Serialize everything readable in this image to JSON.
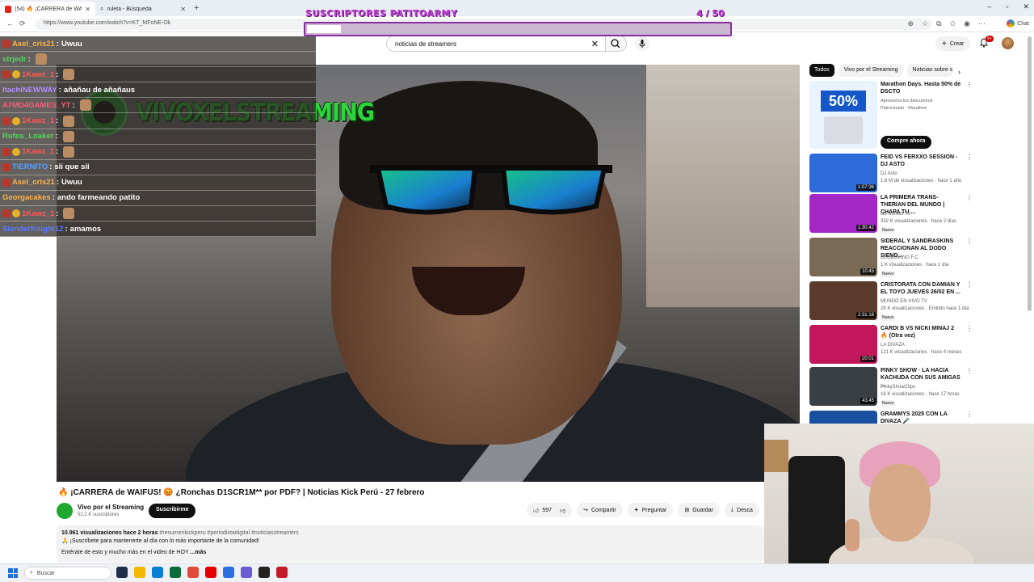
{
  "browser": {
    "tabs": [
      {
        "label": "(54) 🔥 ¡CARRERA de WAIFUS! 😡",
        "active": true
      },
      {
        "label": "ruleta - Búsqueda",
        "active": false
      }
    ],
    "new_tab": "+",
    "url": "https://www.youtube.com/watch?v=KT_MFoNE-Ok",
    "chat_button": "Chat"
  },
  "overlay": {
    "title": "SUSCRIPTORES PATITOARMY",
    "count": "4 / 50",
    "progress": 0.08
  },
  "youtube": {
    "search_value": "noticias de streamers",
    "create_label": "Crear",
    "notifications_badge": "9+"
  },
  "video": {
    "logo_text": "VIVOXELSTREAMING",
    "title": "🔥 ¡CARRERA de WAIFUS! 😡 ¿Ronchas D1SCR1M** por PDF? | Noticias Kick Perú - 27 febrero",
    "channel": "Vivo por el Streaming",
    "subscribers": "52,2 K suscriptores",
    "subscribe_label": "Suscribirme",
    "likes": "597",
    "share_label": "Compartir",
    "ask_label": "Preguntar",
    "save_label": "Guardar",
    "download_label": "Desca",
    "desc_stats": "10.961 visualizaciones  hace 2 horas",
    "desc_tags": "#resumenkickperu #periodistadigital #noticiasstreamers",
    "desc_line2": "🙏 ¡Suscríbete para mantenerte al día con lo más importante de la comunidad!",
    "desc_line3": "Entérate de esto y mucho más en el video de HOY",
    "desc_more": "...más"
  },
  "chat": [
    {
      "user": "Axel_cris21",
      "color": "#ffb347",
      "badges": [
        "badge1"
      ],
      "msg": "Uwuu",
      "emote": false
    },
    {
      "user": "strjedr",
      "color": "#4ddc5b",
      "badges": [],
      "msg": "",
      "emote": true
    },
    {
      "user": "1Kawz_1",
      "color": "#ff5a5a",
      "badges": [
        "badge1",
        "badge2"
      ],
      "msg": "",
      "emote": true
    },
    {
      "user": "ItachiNEWWAY",
      "color": "#b28cff",
      "badges": [],
      "msg": "añañau de añañaus",
      "emote": false
    },
    {
      "user": "A7MD4GAMES_YT",
      "color": "#ff5a7a",
      "badges": [],
      "msg": "",
      "emote": true
    },
    {
      "user": "1Kawz_1",
      "color": "#ff5a5a",
      "badges": [
        "badge1",
        "badge2"
      ],
      "msg": "",
      "emote": true
    },
    {
      "user": "Rufos_Loaker",
      "color": "#4ddc5b",
      "badges": [],
      "msg": "",
      "emote": true
    },
    {
      "user": "1Kawz_1",
      "color": "#ff5a5a",
      "badges": [
        "badge1",
        "badge2"
      ],
      "msg": "",
      "emote": true
    },
    {
      "user": "TIERNITO",
      "color": "#5aa0ff",
      "badges": [
        "badge1"
      ],
      "msg": "sii que sii",
      "emote": false
    },
    {
      "user": "Axel_cris21",
      "color": "#ffb347",
      "badges": [
        "badge1"
      ],
      "msg": "Uwuu",
      "emote": false
    },
    {
      "user": "Georgacakes",
      "color": "#ffb347",
      "badges": [],
      "msg": "ando farmeando patito",
      "emote": false
    },
    {
      "user": "1Kawz_1",
      "color": "#ff5a5a",
      "badges": [
        "badge1",
        "badge2"
      ],
      "msg": "",
      "emote": true
    },
    {
      "user": "SlenderKnight12",
      "color": "#5a7aff",
      "badges": [],
      "msg": "amamos",
      "emote": false
    }
  ],
  "sidebar": {
    "chips": [
      "Todos",
      "Vivo por el Streaming",
      "Noticias sobre s"
    ],
    "ad": {
      "thumb_text": "50%",
      "title": "Marathon Days. Hasta 50% de DSCTO",
      "subtitle": "Aprovecha los descuentos",
      "sponsor": "Patrocinado · Marathon",
      "cta": "Compre ahora"
    },
    "items": [
      {
        "title": "FEID VS FERXXO SESSION - DJ ASTO",
        "channel": "DJ Asto",
        "views": "1,6 M de visualizaciones · hace 1 año",
        "duration": "1:07:36",
        "new": "",
        "thumb": "#2d6bd8"
      },
      {
        "title": "LA PRIMERA TRANS-THERIAN DEL MUNDO | CHAPA TU ...",
        "channel": "No Somos TV",
        "views": "332 K visualizaciones · hace 2 días",
        "duration": "1:30:42",
        "new": "Nuevo",
        "thumb": "#a327c4"
      },
      {
        "title": "SIDERAL Y SANDRASKINS REACCIONAN AL DODO SIEND...",
        "channel": "GLOBOKING F.C",
        "views": "1 K visualizaciones · hace 1 día",
        "duration": "10:45",
        "new": "Nuevo",
        "thumb": "#7a6a55"
      },
      {
        "title": "CRISTORATA CON DAMIAN Y EL TOYO JUEVES 26/02 EN ...",
        "channel": "MUNDO EN VIVO TV",
        "views": "28 K visualizaciones · Emitido hace 1 día",
        "duration": "2:31:16",
        "new": "Nuevo",
        "thumb": "#5a3a2a"
      },
      {
        "title": "CARDI B VS NICKI MINAJ 2 🔥 (Otra vez)",
        "channel": "LA DIVAZA",
        "views": "121 K visualizaciones · hace 4 meses",
        "duration": "20:01",
        "new": "",
        "thumb": "#c2185b"
      },
      {
        "title": "PINKY SHOW · LA HACIA KACHUDA CON SUS AMIGAS ...",
        "channel": "PinkyShowClips",
        "views": "18 K visualizaciones · hace 17 horas",
        "duration": "43:45",
        "new": "Nuevo",
        "thumb": "#3a3f44"
      },
      {
        "title": "GRAMMYS 2025 CON LA DIVAZA 🎤",
        "channel": "",
        "views": "",
        "duration": "",
        "new": "",
        "thumb": "#1b4fa0"
      }
    ]
  },
  "taskbar": {
    "search_label": "Buscar",
    "apps": [
      "#1f2f4a",
      "#f3b700",
      "#0a7fd6",
      "#0b6b3a",
      "#e24a3b",
      "#e60000",
      "#2b6fe0",
      "#6b5bd6",
      "#222222",
      "#c21b2a"
    ]
  }
}
